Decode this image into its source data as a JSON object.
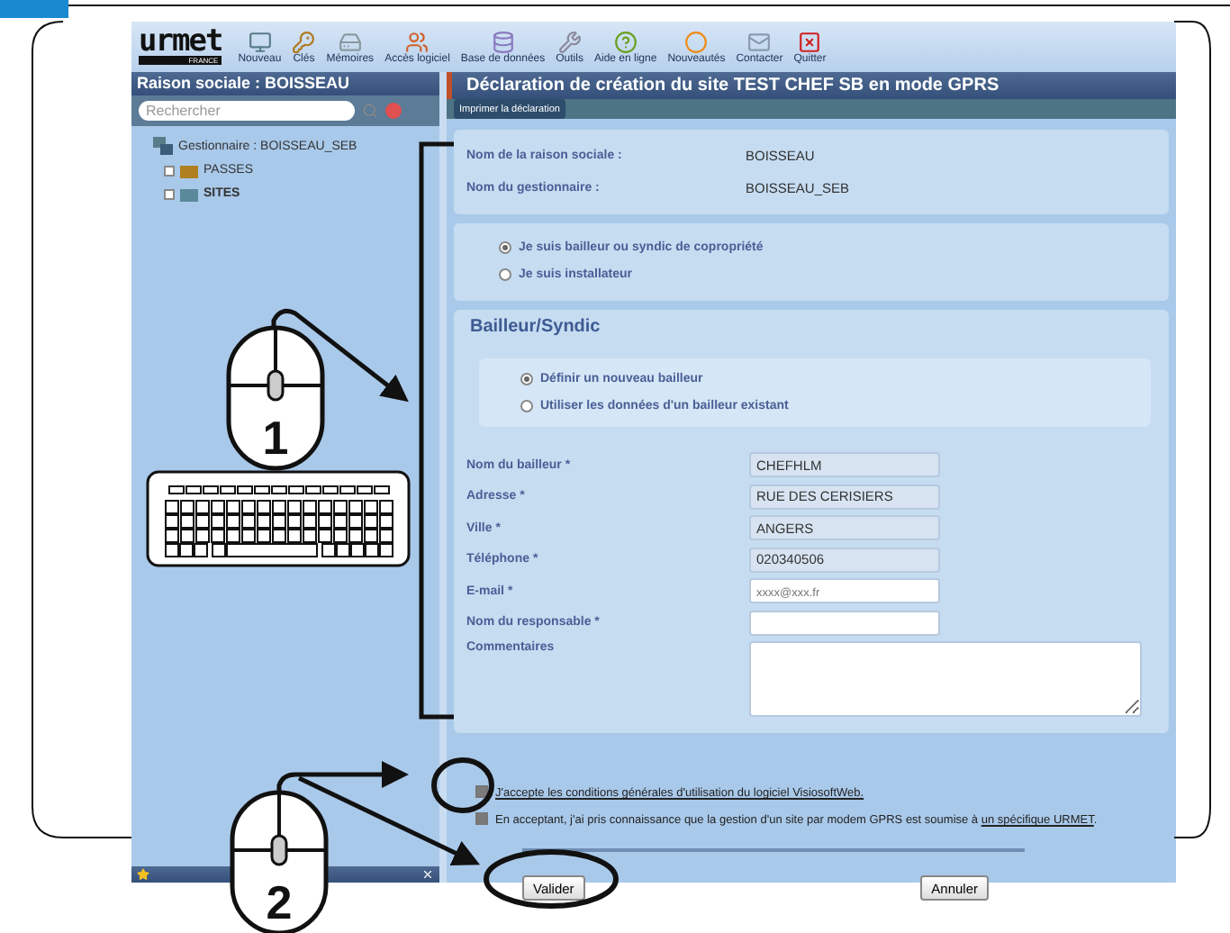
{
  "toolbar": {
    "logo": "urmet",
    "logo_sub": "FRANCE",
    "buttons": [
      {
        "label": "Nouveau"
      },
      {
        "label": "Clés"
      },
      {
        "label": "Mémoires"
      },
      {
        "label": "Accès logiciel"
      },
      {
        "label": "Base de données"
      },
      {
        "label": "Outils"
      },
      {
        "label": "Aide en ligne"
      },
      {
        "label": "Nouveautés"
      },
      {
        "label": "Contacter"
      },
      {
        "label": "Quitter"
      }
    ]
  },
  "sidebar": {
    "title": "Raison sociale : BOISSEAU",
    "search": {
      "placeholder": "Rechercher"
    },
    "tree": [
      {
        "label": "Gestionnaire : BOISSEAU_SEB",
        "children": [
          {
            "label": "PASSES",
            "selected": false
          },
          {
            "label": "SITES",
            "selected": true
          }
        ]
      }
    ]
  },
  "main": {
    "title": "Déclaration de création du site TEST CHEF SB en mode GPRS",
    "print_button": "Imprimer la déclaration",
    "info": [
      {
        "label": "Nom de la raison sociale :",
        "value": "BOISSEAU"
      },
      {
        "label": "Nom du gestionnaire :",
        "value": "BOISSEAU_SEB"
      }
    ],
    "roles": [
      {
        "label": "Je suis bailleur ou syndic de copropriété",
        "selected": true
      },
      {
        "label": "Je suis installateur",
        "selected": false
      }
    ],
    "section_title": "Bailleur/Syndic",
    "bailleur_options": [
      {
        "label": "Définir un nouveau bailleur",
        "selected": true
      },
      {
        "label": "Utiliser les données d'un bailleur existant",
        "selected": false
      }
    ],
    "fields": [
      {
        "kind": "input",
        "label": "Nom du bailleur *",
        "value": "CHEFHLM",
        "disabled": true
      },
      {
        "kind": "input",
        "label": "Adresse *",
        "value": "RUE DES CERISIERS",
        "disabled": true
      },
      {
        "kind": "input",
        "label": "Ville *",
        "value": "ANGERS",
        "disabled": true
      },
      {
        "kind": "input",
        "label": "Téléphone *",
        "value": "020340506",
        "disabled": true
      },
      {
        "kind": "input",
        "label": "E-mail *",
        "placeholder": "xxxx@xxx.fr",
        "disabled": false
      },
      {
        "kind": "input",
        "label": "Nom du responsable *",
        "disabled": false
      },
      {
        "kind": "textarea",
        "label": "Commentaires",
        "disabled": false
      }
    ],
    "agreements": [
      {
        "text": "J'accepte les conditions générales d'utilisation du logiciel VisiosoftWeb.",
        "link": true,
        "checked": true
      },
      {
        "text": "En acceptant, j'ai pris connaissance que la gestion d'un site par modem GPRS est soumise à",
        "link_text": "un spécifique URMET",
        "suffix": ".",
        "link": false,
        "checked": true
      }
    ],
    "buttons": [
      {
        "label": "Valider"
      },
      {
        "label": "Annuler"
      }
    ]
  },
  "annotations": {
    "steps": [
      "1",
      "2"
    ]
  }
}
